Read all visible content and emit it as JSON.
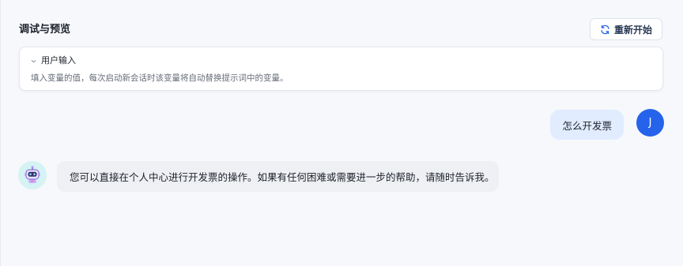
{
  "panel": {
    "title": "调试与预览",
    "restart_label": "重新开始"
  },
  "variables": {
    "header": "用户输入",
    "description": "填入变量的值，每次启动新会话时该变量将自动替换提示词中的变量。"
  },
  "messages": [
    {
      "role": "user",
      "text": "怎么开发票",
      "avatar_initial": "J"
    },
    {
      "role": "assistant",
      "text": "您可以直接在个人中心进行开发票的操作。如果有任何困难或需要进一步的帮助，请随时告诉我。"
    }
  ],
  "colors": {
    "user_avatar": "#2563eb",
    "user_bubble": "#e1ecff",
    "bot_bubble": "#eef0f4",
    "bot_avatar_bg": "#d5f2f5"
  },
  "icons": {
    "restart": "refresh-icon",
    "collapse": "chevron-down-icon",
    "bot": "robot-icon"
  }
}
